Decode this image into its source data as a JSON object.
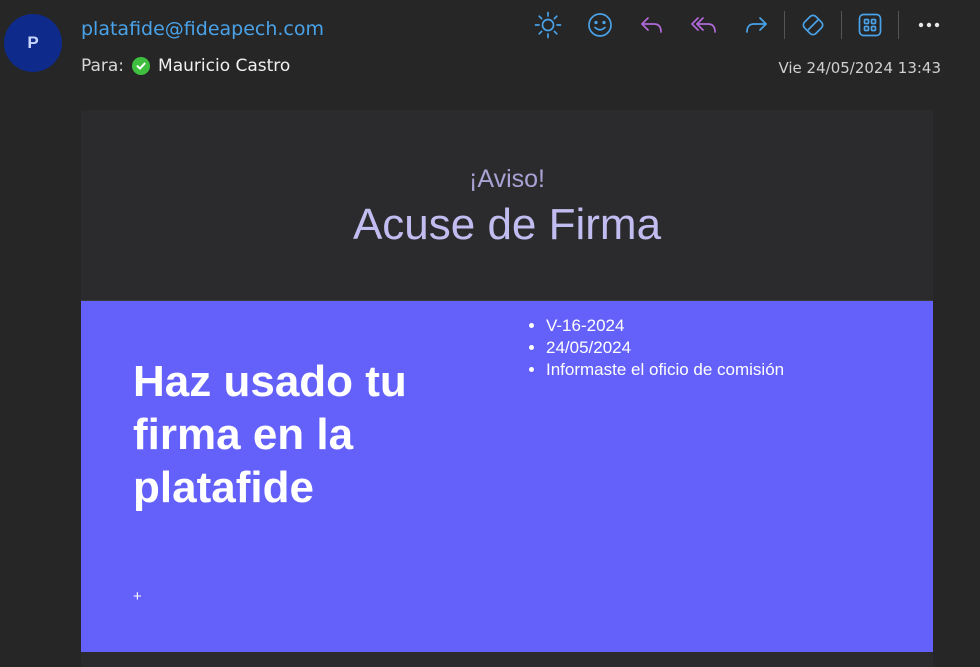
{
  "header": {
    "avatar_letter": "P",
    "sender_email": "platafide@fideapech.com",
    "to_label": "Para:",
    "recipient_name": "Mauricio Castro",
    "date": "Vie 24/05/2024 13:43"
  },
  "toolbar": {
    "icons": [
      "sun-icon",
      "smiley-icon",
      "reply-icon",
      "reply-all-icon",
      "forward-icon",
      "immersive-reader-icon",
      "apps-icon",
      "more-icon"
    ],
    "colors": {
      "blue": "#4aa2e8",
      "purple": "#b06ad8"
    },
    "more_label": "•••"
  },
  "email": {
    "kicker": "¡Aviso!",
    "title": "Acuse de Firma",
    "headline": "Haz usado tu firma en la platafide",
    "details": [
      "V-16-2024",
      "24/05/2024",
      "Informaste el oficio de comisión"
    ],
    "plus": "+",
    "accent_color": "#6461fb"
  }
}
